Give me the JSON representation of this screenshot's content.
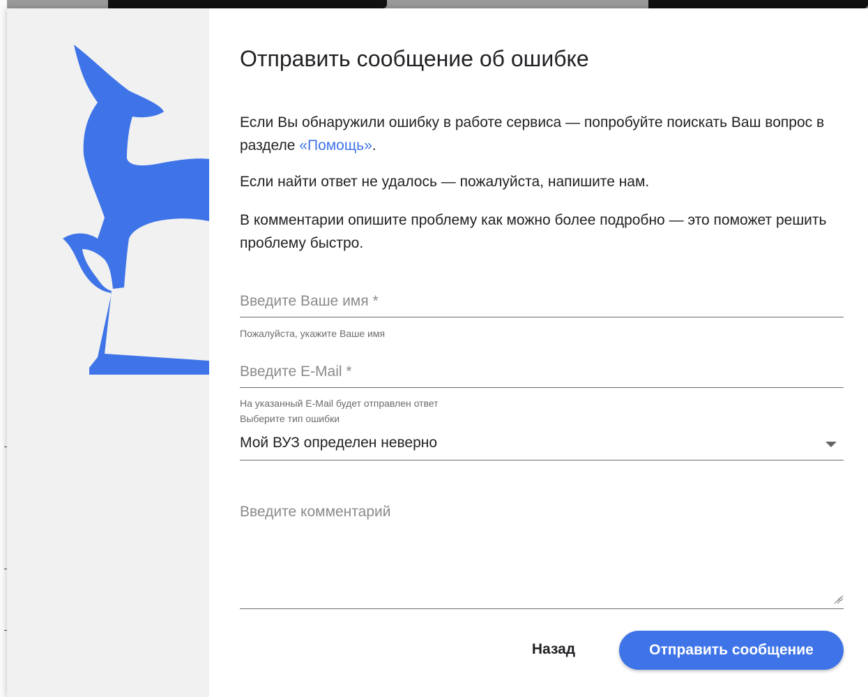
{
  "colors": {
    "accent": "#3f74e8",
    "side_panel": "#f1f1f1",
    "text": "#202124",
    "hint_text": "#6b6b6b"
  },
  "dialog": {
    "title": "Отправить сообщение об ошибке",
    "intro_before_link": "Если Вы обнаружили ошибку в работе сервиса — попробуйте поискать Ваш вопрос в разделе ",
    "help_link": "«Помощь»",
    "intro_after_link": ".",
    "paragraph2": "Если найти ответ не удалось — пожалуйста, напишите нам.",
    "paragraph3": "В комментарии опишите проблему как можно более подробно — это поможет решить проблему быстро."
  },
  "form": {
    "name": {
      "placeholder": "Введите Ваше имя *",
      "value": "",
      "hint": "Пожалуйста, укажите Ваше имя"
    },
    "email": {
      "placeholder": "Введите E-Mail *",
      "value": "",
      "hint": "На указанный E-Mail будет отправлен ответ"
    },
    "error_type": {
      "label": "Выберите тип ошибки",
      "selected": "Мой ВУЗ определен неверно"
    },
    "comment": {
      "placeholder": "Введите комментарий",
      "value": ""
    }
  },
  "buttons": {
    "back": "Назад",
    "send": "Отправить сообщение"
  },
  "icons": {
    "logo": "deer-logo",
    "dropdown": "caret-down-icon",
    "resize": "resize-grip-icon"
  }
}
